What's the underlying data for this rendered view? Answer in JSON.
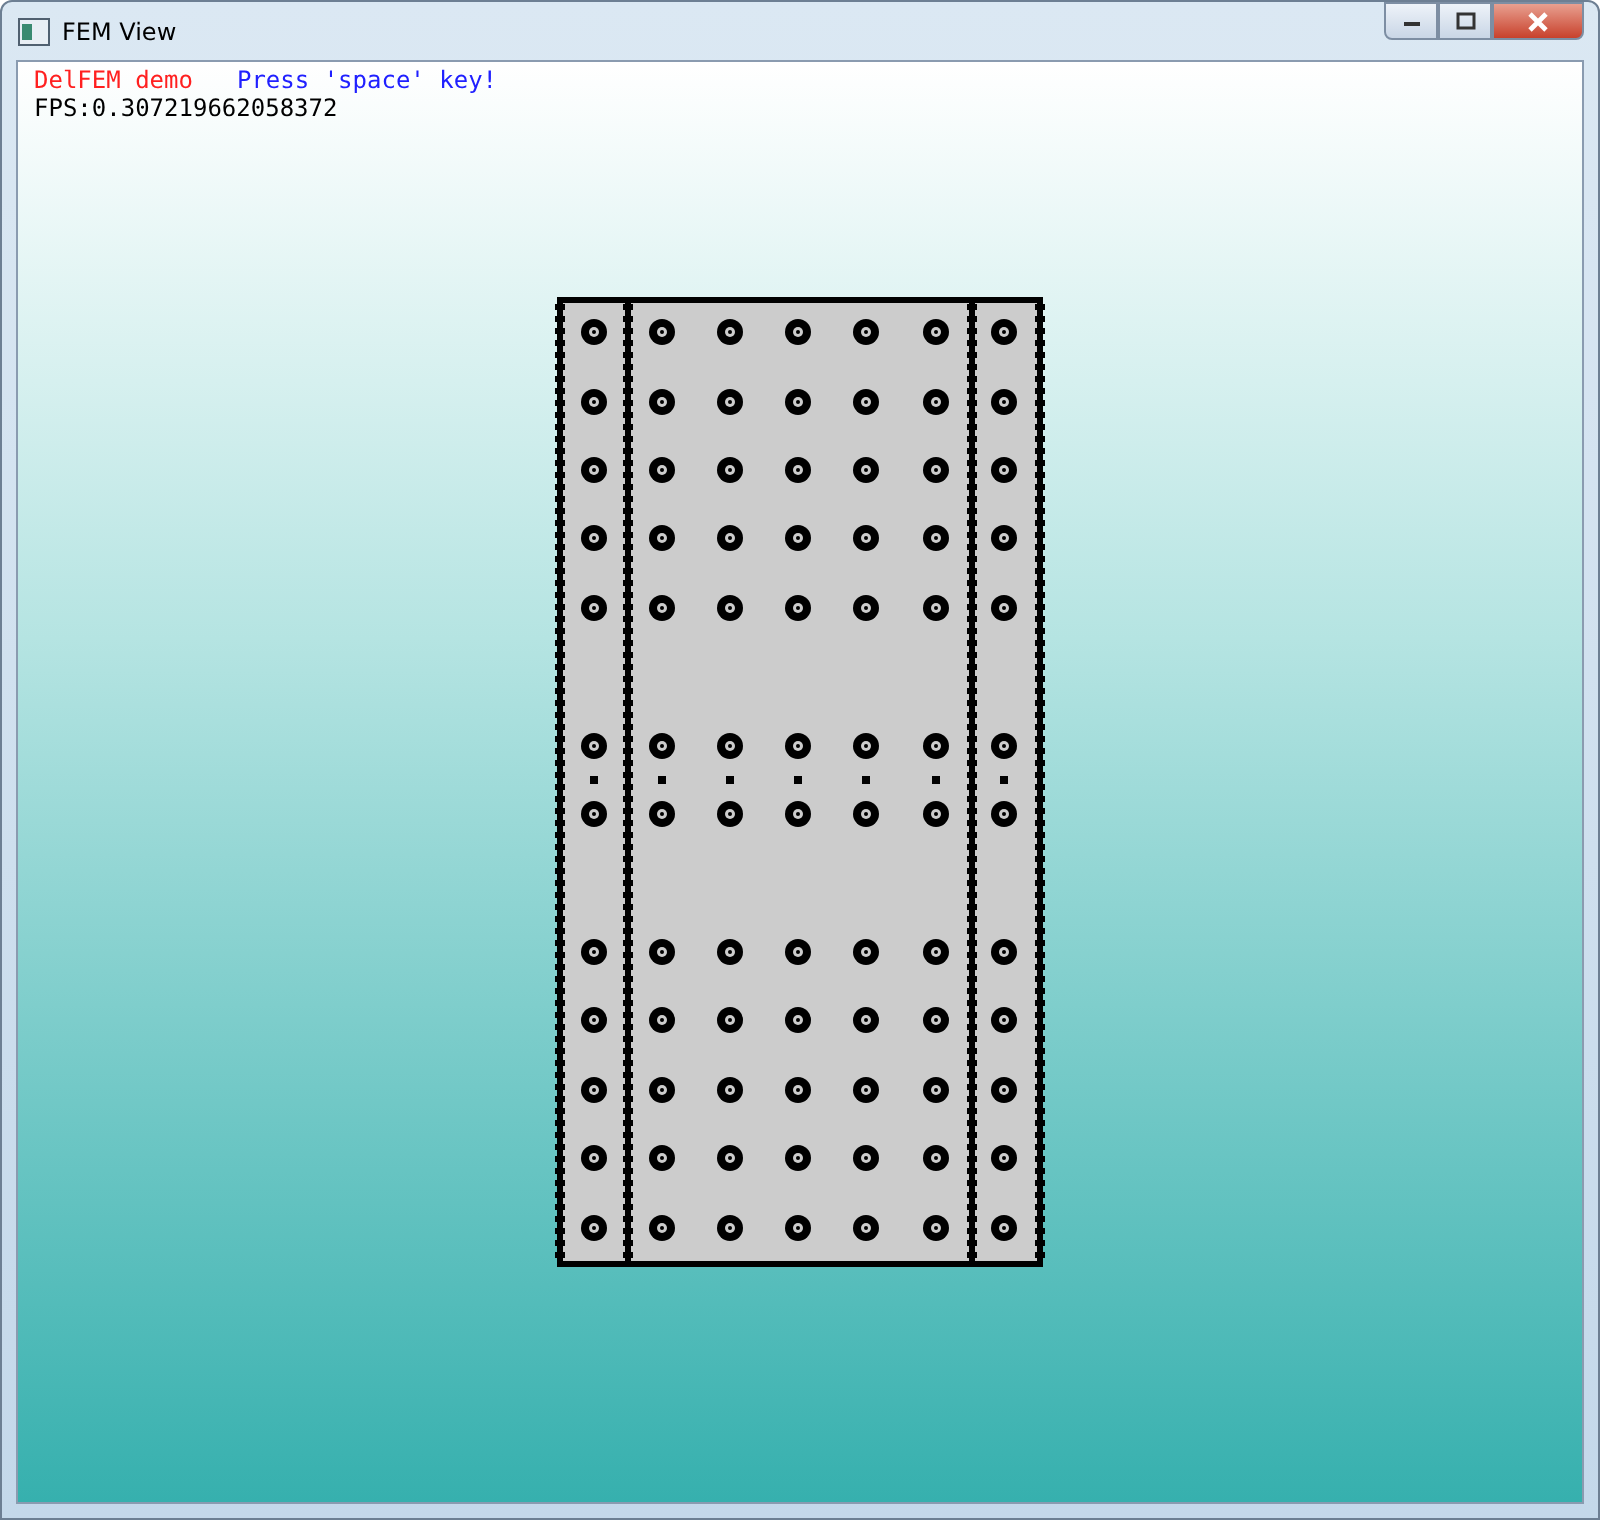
{
  "window": {
    "title": "FEM View"
  },
  "overlay": [
    {
      "text": "DelFEM demo",
      "color": "#ff2020"
    },
    {
      "text": "Press 'space' key!",
      "color": "#2020ff"
    },
    {
      "text": "FPS:0.307219662058372",
      "color": "#000000"
    }
  ]
}
